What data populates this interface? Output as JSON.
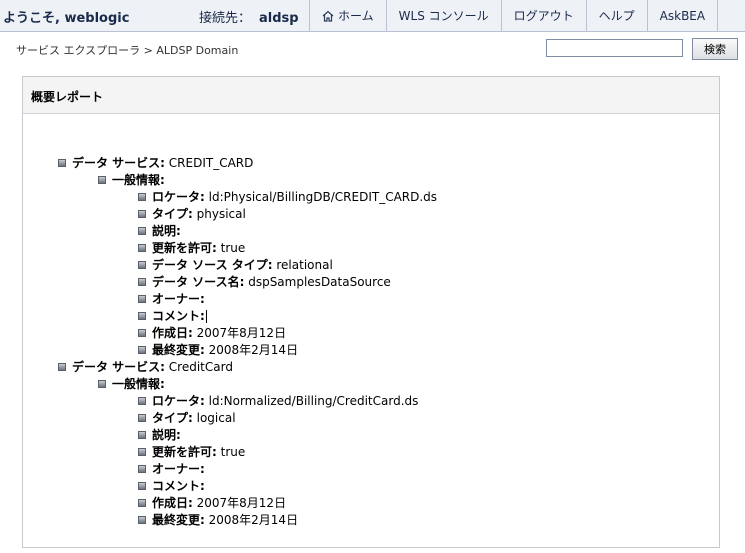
{
  "header": {
    "welcome": "ようこそ, weblogic",
    "connect_label": "接続先：",
    "connect_value": "aldsp",
    "nav": [
      {
        "label": "ホーム",
        "icon": "home-icon"
      },
      {
        "label": "WLS コンソール"
      },
      {
        "label": "ログアウト"
      },
      {
        "label": "ヘルプ"
      },
      {
        "label": "AskBEA"
      }
    ]
  },
  "breadcrumb": "サービス エクスプローラ > ALDSP Domain",
  "search": {
    "value": "",
    "button": "検索"
  },
  "panel": {
    "title": "概要レポート",
    "services": [
      {
        "label": "データ サービス:",
        "value": " CREDIT_CARD",
        "general": {
          "label": "一般情報:",
          "items": [
            {
              "label": "ロケータ:",
              "value": " ld:Physical/BillingDB/CREDIT_CARD.ds"
            },
            {
              "label": "タイプ:",
              "value": " physical"
            },
            {
              "label": "説明:",
              "value": ""
            },
            {
              "label": "更新を許可:",
              "value": " true"
            },
            {
              "label": "データ ソース タイプ:",
              "value": " relational"
            },
            {
              "label": "データ ソース名:",
              "value": " dspSamplesDataSource"
            },
            {
              "label": "オーナー:",
              "value": ""
            },
            {
              "label": "コメント:",
              "value": ""
            },
            {
              "label": "作成日:",
              "value": " 2007年8月12日"
            },
            {
              "label": "最終変更:",
              "value": " 2008年2月14日"
            }
          ]
        }
      },
      {
        "label": "データ サービス:",
        "value": " CreditCard",
        "general": {
          "label": "一般情報:",
          "items": [
            {
              "label": "ロケータ:",
              "value": " ld:Normalized/Billing/CreditCard.ds"
            },
            {
              "label": "タイプ:",
              "value": " logical"
            },
            {
              "label": "説明:",
              "value": ""
            },
            {
              "label": "更新を許可:",
              "value": " true"
            },
            {
              "label": "オーナー:",
              "value": ""
            },
            {
              "label": "コメント:",
              "value": ""
            },
            {
              "label": "作成日:",
              "value": " 2007年8月12日"
            },
            {
              "label": "最終変更:",
              "value": " 2008年2月14日"
            }
          ]
        }
      }
    ]
  }
}
